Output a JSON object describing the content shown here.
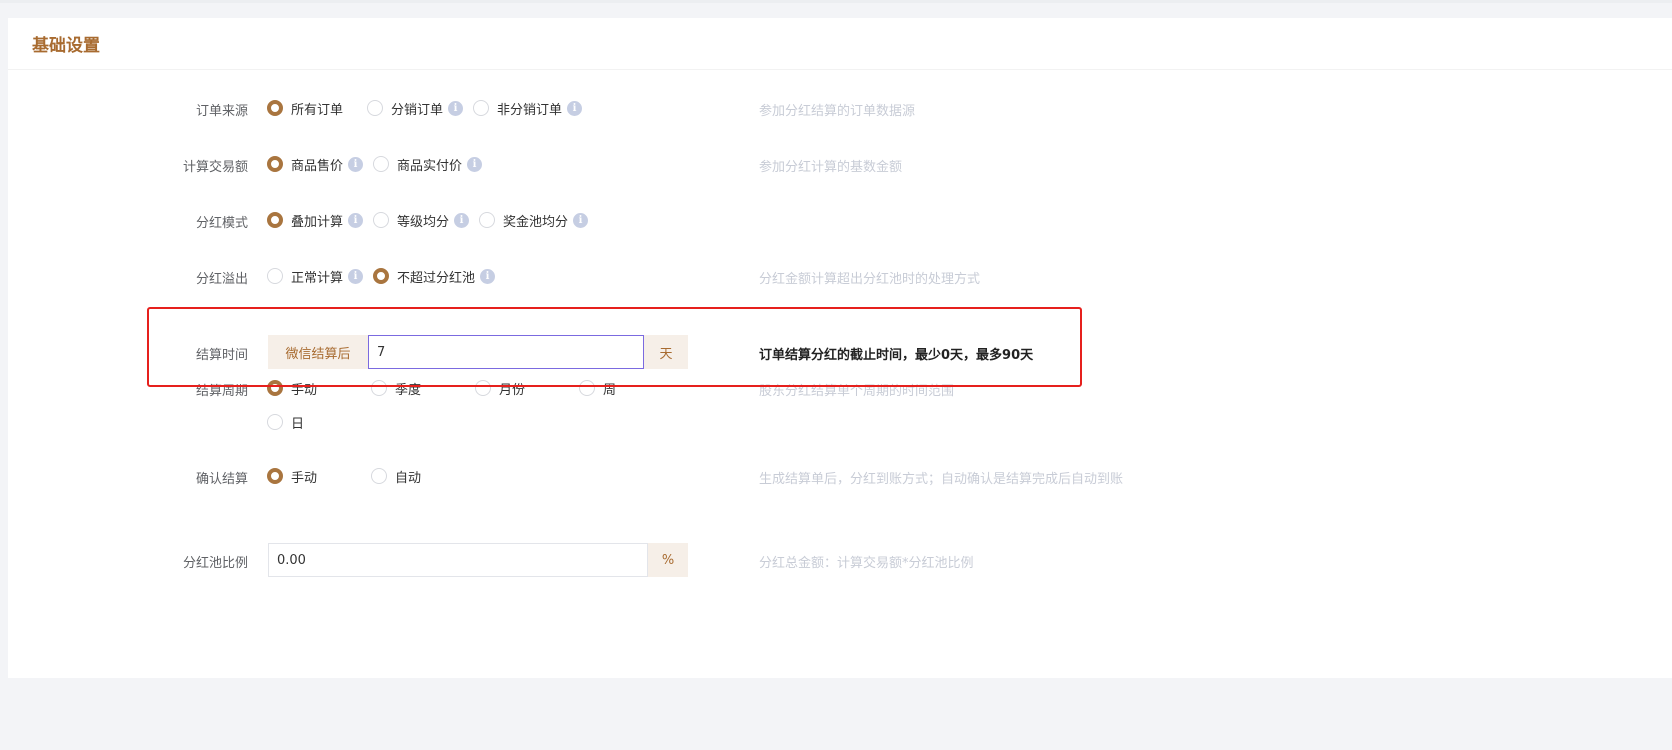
{
  "section_title": "基础设置",
  "rows": {
    "order_source": {
      "label": "订单来源",
      "options": [
        {
          "label": "所有订单",
          "checked": true,
          "info": false
        },
        {
          "label": "分销订单",
          "checked": false,
          "info": true
        },
        {
          "label": "非分销订单",
          "checked": false,
          "info": true
        }
      ],
      "hint": "参加分红结算的订单数据源"
    },
    "trade_amount": {
      "label": "计算交易额",
      "options": [
        {
          "label": "商品售价",
          "checked": true,
          "info": true
        },
        {
          "label": "商品实付价",
          "checked": false,
          "info": true
        }
      ],
      "hint": "参加分红计算的基数金额"
    },
    "dividend_mode": {
      "label": "分红模式",
      "options": [
        {
          "label": "叠加计算",
          "checked": true,
          "info": true
        },
        {
          "label": "等级均分",
          "checked": false,
          "info": true
        },
        {
          "label": "奖金池均分",
          "checked": false,
          "info": true
        }
      ]
    },
    "dividend_overflow": {
      "label": "分红溢出",
      "options": [
        {
          "label": "正常计算",
          "checked": false,
          "info": true
        },
        {
          "label": "不超过分红池",
          "checked": true,
          "info": true
        }
      ],
      "hint": "分红金额计算超出分红池时的处理方式"
    },
    "settle_time": {
      "label": "结算时间",
      "prefix": "微信结算后",
      "value": "7",
      "suffix": "天",
      "hint": "订单结算分红的截止时间，最少0天，最多90天"
    },
    "settle_cycle": {
      "label": "结算周期",
      "options": [
        {
          "label": "手动",
          "checked": true
        },
        {
          "label": "季度",
          "checked": false
        },
        {
          "label": "月份",
          "checked": false
        },
        {
          "label": "周",
          "checked": false
        },
        {
          "label": "日",
          "checked": false
        }
      ],
      "hint": "股东分红结算单个周期的时间范围"
    },
    "confirm_settle": {
      "label": "确认结算",
      "options": [
        {
          "label": "手动",
          "checked": true
        },
        {
          "label": "自动",
          "checked": false
        }
      ],
      "hint": "生成结算单后，分红到账方式；自动确认是结算完成后自动到账"
    },
    "pool_ratio": {
      "label": "分红池比例",
      "value": "0.00",
      "suffix": "%",
      "hint": "分红总金额：计算交易额*分红池比例"
    }
  },
  "info_glyph": "i",
  "colors": {
    "accent": "#a9753f",
    "title": "#a86b30",
    "highlight": "#e6201d",
    "hint": "#c8ccd6"
  }
}
